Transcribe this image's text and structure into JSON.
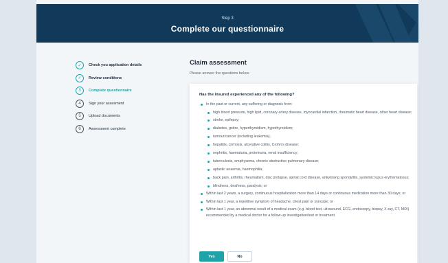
{
  "hero": {
    "step": "Step 3",
    "title": "Complete our questionnaire"
  },
  "steps": [
    {
      "num": "✓",
      "label": "Check you application details",
      "state": "done"
    },
    {
      "num": "✓",
      "label": "Review conditions",
      "state": "done"
    },
    {
      "num": "3",
      "label": "Complete questionnaire",
      "state": "active"
    },
    {
      "num": "4",
      "label": "Sign your assesment",
      "state": "todo"
    },
    {
      "num": "5",
      "label": "Upload documents",
      "state": "todo"
    },
    {
      "num": "6",
      "label": "Assessment complete",
      "state": "todo"
    }
  ],
  "claim": {
    "title": "Claim assessment",
    "subtitle": "Please answer the questions below."
  },
  "question": {
    "title": "Has the insured experienced any of the following?",
    "item1": "In the past or current, any suffering or diagnosis from:",
    "subitems": [
      "high blood pressure, high lipid, coronary artery disease, myocardial infarction, rheumatic heart disease, other heart disease;",
      "stroke, epilepsy;",
      "diabetes, goitre, hyperthyroidism, hypothyroidism;",
      "tumour/cancer (including leukemia);",
      "hepatitis, cirrhosis, ulcerative colitis, Crohn's disease;",
      "nephritis, haematuria, proteinuria, renal insufficiency;",
      "tuberculosis, emphysema, chronic obstructive pulmonary disease;",
      "aplastic anaemia, haemophilia;",
      "back pain, arthritis, rheumatism, disc prolapse, spinal cord disease, ankylosing spondylitis, systemic lupus erythematosus;",
      "blindness, deafness, paralysis; or"
    ],
    "item2": "Within last 2 years, a surgery, continuous hospitalization more than 14 days or continuous medication more than 30 days; or",
    "item3": "Within last 1 year, a repetitive symptom of headache, chest pain or syncope; or",
    "item4": "Within last 1 year, an abnormal result of a medical exam (e.g. blood test, ultrasound, ECG, endoscopy, biopsy, X-ray, CT, MRI) recommended by a medical doctor for a follow-up investigation/test or treatment."
  },
  "buttons": {
    "yes": "Yes",
    "no": "No"
  },
  "colors": {
    "accent": "#1fa3a8",
    "hero": "#113a5a"
  }
}
